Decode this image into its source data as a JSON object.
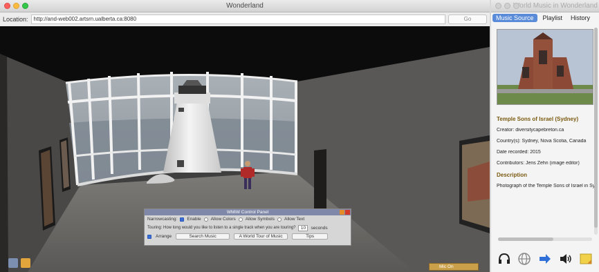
{
  "main_window": {
    "title": "Wonderland",
    "location_label": "Location:",
    "location_value": "http://and-web002.artsrn.ualberta.ca:8080",
    "go_label": "Go"
  },
  "control_panel": {
    "title": "WMiW Control Panel",
    "narrowcasting_label": "Narrowcasting:",
    "enable_label": "Enable",
    "allow_colors_label": "Allow Colors",
    "allow_symbols_label": "Allow Symbols",
    "allow_text_label": "Allow Text",
    "touring_question": "Touring: How long would you like to listen to a single track when you are touring?",
    "touring_seconds": "10",
    "seconds_label": "seconds",
    "arrange_label": "Arrange",
    "search_music_label": "Search Music",
    "world_tour_label": "A World Tour of Music",
    "tips_label": "Tips"
  },
  "mic": {
    "label": "Mic On"
  },
  "side_window": {
    "title": "World Music in Wonderland",
    "tabs": [
      "Music Source",
      "Playlist",
      "History"
    ],
    "item_title": "Temple Sons of Israel (Sydney)",
    "creator": "Creator: diversitycapebreton.ca",
    "country": "Country(s):   Sydney, Nova Scotia, Canada",
    "date": "Date recorded: 2015",
    "contributors": "Contributors: Jens Zehn (image editor)",
    "description_heading": "Description",
    "description": "Photograph of the Temple Sons of Israel in Syd"
  },
  "colors": {
    "title_text": "#7a5a10",
    "active_tab": "#5a8bd8",
    "panel_title": "#7f88a8"
  },
  "icons": [
    "headphones-icon",
    "globe-icon",
    "arrow-right-icon",
    "speaker-icon",
    "note-icon"
  ]
}
